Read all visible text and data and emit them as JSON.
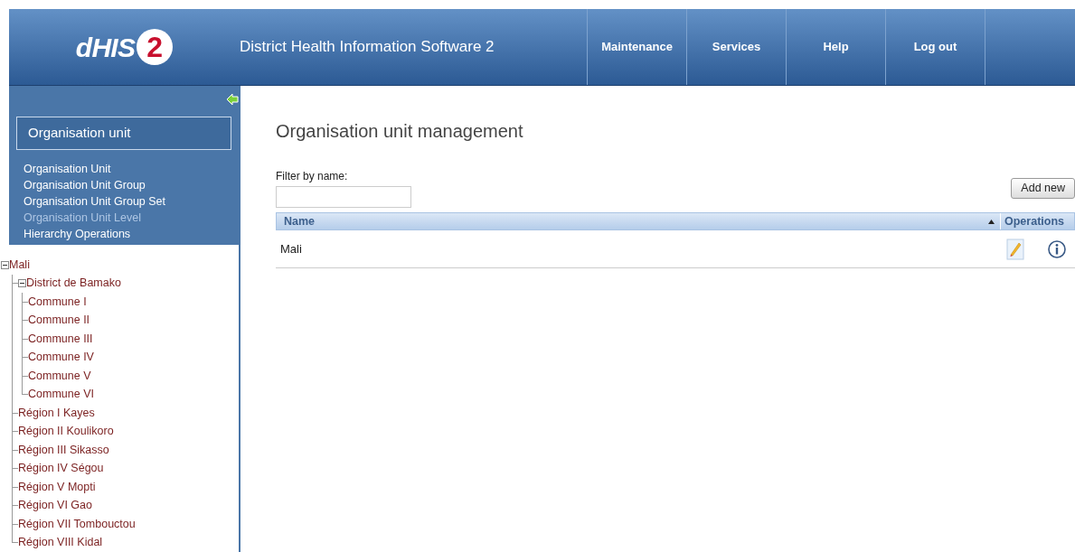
{
  "header": {
    "logo": {
      "text": "dHIS",
      "badge": "2"
    },
    "title": "District Health Information Software 2",
    "nav": [
      "Maintenance",
      "Services",
      "Help",
      "Log out"
    ]
  },
  "sidebar": {
    "section_title": "Organisation unit",
    "menu": [
      {
        "label": "Organisation Unit",
        "selected": false
      },
      {
        "label": "Organisation Unit Group",
        "selected": false
      },
      {
        "label": "Organisation Unit Group Set",
        "selected": false
      },
      {
        "label": "Organisation Unit Level",
        "selected": true
      },
      {
        "label": "Hierarchy Operations",
        "selected": false
      }
    ],
    "tree": [
      {
        "label": "Mali",
        "expanded": true,
        "children": [
          {
            "label": "District de Bamako",
            "expanded": true,
            "children": [
              {
                "label": "Commune I"
              },
              {
                "label": "Commune II"
              },
              {
                "label": "Commune III"
              },
              {
                "label": "Commune IV"
              },
              {
                "label": "Commune V"
              },
              {
                "label": "Commune VI"
              }
            ]
          },
          {
            "label": "Région I Kayes"
          },
          {
            "label": "Région II Koulikoro"
          },
          {
            "label": "Région III Sikasso"
          },
          {
            "label": "Région IV Ségou"
          },
          {
            "label": "Région V Mopti"
          },
          {
            "label": "Région VI Gao"
          },
          {
            "label": "Région VII Tombouctou"
          },
          {
            "label": "Région VIII Kidal"
          }
        ]
      }
    ]
  },
  "main": {
    "title": "Organisation unit management",
    "filter_label": "Filter by name:",
    "add_button": "Add new",
    "table": {
      "columns": [
        "Name",
        "Operations"
      ],
      "rows": [
        {
          "name": "Mali"
        }
      ]
    }
  }
}
